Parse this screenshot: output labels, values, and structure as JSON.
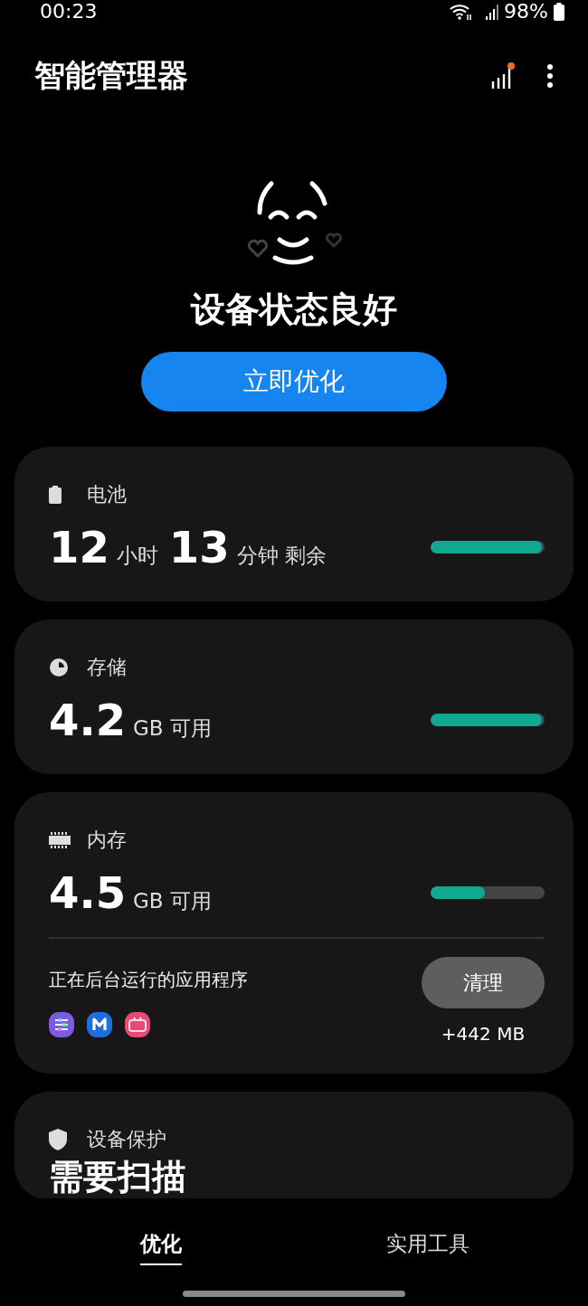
{
  "status_bar": {
    "time": "00:23",
    "battery": "98%"
  },
  "header": {
    "title": "智能管理器"
  },
  "hero": {
    "status": "设备状态良好",
    "button": "立即优化"
  },
  "cards": [
    {
      "kind": "battery",
      "title": "电池",
      "value": [
        {
          "kind": "number",
          "text": "12"
        },
        {
          "kind": "unit",
          "text": "小时"
        },
        {
          "kind": "number",
          "text": "13"
        },
        {
          "kind": "unit",
          "text": "分钟 剩余"
        }
      ],
      "level": 0.98
    },
    {
      "kind": "storage",
      "title": "存储",
      "value": [
        {
          "kind": "number",
          "text": "4.2"
        },
        {
          "kind": "unit",
          "text": "GB 可用"
        }
      ],
      "level": 0.98
    },
    {
      "kind": "memory",
      "title": "内存",
      "value": [
        {
          "kind": "number",
          "text": "4.5"
        },
        {
          "kind": "unit",
          "text": "GB 可用"
        }
      ],
      "level": 0.48,
      "background": {
        "label": "正在后台运行的应用程序",
        "button": "清理",
        "freed": "+442 MB"
      }
    },
    {
      "kind": "protection",
      "title": "设备保护",
      "value": [
        {
          "kind": "heading",
          "text": "需要扫描"
        }
      ]
    }
  ],
  "tabs": [
    {
      "label": "优化",
      "selected": true
    },
    {
      "label": "实用工具",
      "selected": false
    }
  ]
}
